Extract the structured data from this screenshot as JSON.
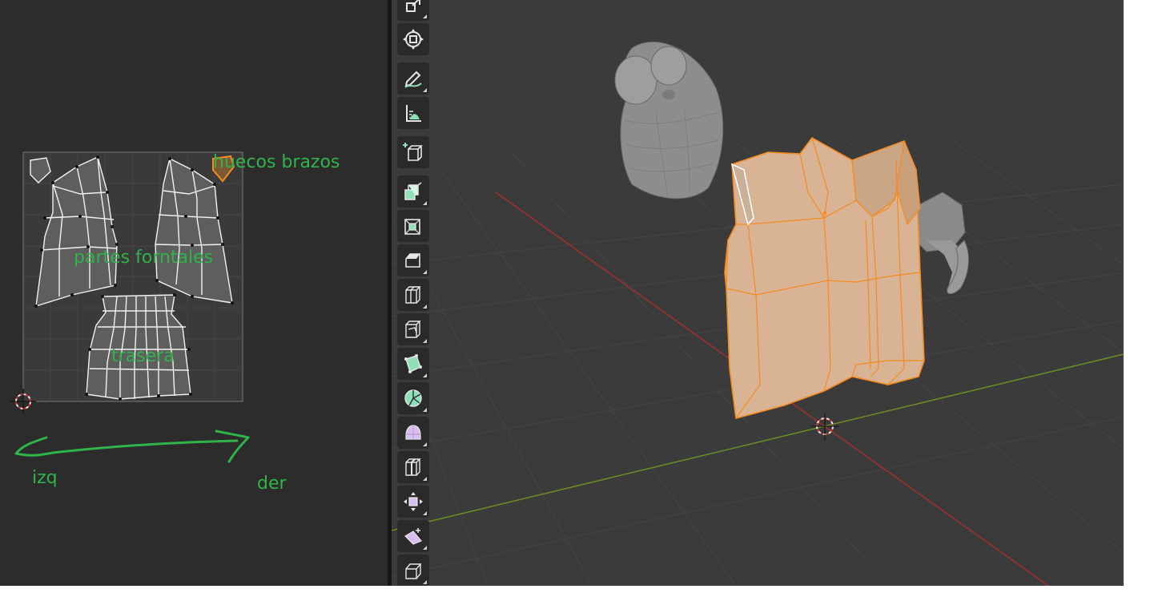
{
  "uv_editor": {
    "annotations": {
      "huecos_brazos": "huecos brazos",
      "partes_frontales": "partes forntales",
      "trasera": "trasera",
      "izq": "izq",
      "der": "der"
    }
  },
  "viewport": {
    "toolbar": [
      {
        "icon": "scale-icon"
      },
      {
        "icon": "transform-icon"
      },
      {
        "icon": "annotate-icon"
      },
      {
        "icon": "measure-icon"
      },
      {
        "icon": "add-cube-icon"
      },
      {
        "icon": "extrude-region-icon"
      },
      {
        "icon": "inset-faces-icon"
      },
      {
        "icon": "bevel-icon"
      },
      {
        "icon": "loop-cut-icon"
      },
      {
        "icon": "knife-icon"
      },
      {
        "icon": "poly-build-icon"
      },
      {
        "icon": "spin-icon"
      },
      {
        "icon": "smooth-icon"
      },
      {
        "icon": "edge-slide-icon"
      },
      {
        "icon": "shrink-fatten-icon"
      },
      {
        "icon": "shear-icon"
      },
      {
        "icon": "rip-region-icon"
      }
    ]
  },
  "colors": {
    "annotation_green": "#2fb34a",
    "selection_orange": "#f58a1e",
    "x_axis_red": "#a03030",
    "y_axis_green": "#6b8e23",
    "tool_accent": "#8fe0b8"
  }
}
